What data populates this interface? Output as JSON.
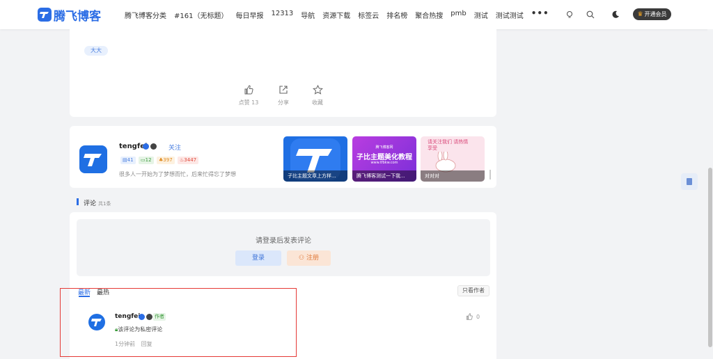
{
  "header": {
    "logo_text": "腾飞博客",
    "nav": [
      "腾飞博客分类",
      "#161（无标题）",
      "每日早报",
      "12313",
      "导航",
      "资源下载",
      "标签云",
      "排名榜",
      "聚合热搜",
      "pmb",
      "测试",
      "测试测试"
    ],
    "more_label": "•••",
    "icons": [
      "lightbulb-icon",
      "search-icon",
      "moon-icon"
    ],
    "vip_label": "开通会员"
  },
  "post": {
    "tag": "大大",
    "actions": [
      {
        "icon": "thumbs-up-icon",
        "label": "点赞 13"
      },
      {
        "icon": "share-icon",
        "label": "分享"
      },
      {
        "icon": "star-icon",
        "label": "收藏"
      }
    ]
  },
  "author": {
    "name": "tengfei",
    "follow_label": "关注",
    "stats": [
      {
        "icon": "article-icon",
        "value": "41",
        "color": "#4a7fe0",
        "bg": "#e8f0fd"
      },
      {
        "icon": "comment-icon",
        "value": "12",
        "color": "#3a9a3a",
        "bg": "#e6f4e6"
      },
      {
        "icon": "like-icon",
        "value": "397",
        "color": "#e08a1e",
        "bg": "#fdf1e0"
      },
      {
        "icon": "fire-icon",
        "value": "3447",
        "color": "#e0483a",
        "bg": "#fde8e6"
      }
    ],
    "bio": "很多人一开始为了梦想而忙，后来忙得忘了梦想",
    "posts": [
      {
        "caption": "子比主题文章上方样..."
      },
      {
        "caption": "腾飞博客测试一下我...",
        "banner_small": "腾飞博客网",
        "banner_big": "子比主题美化教程",
        "banner_url": "www.tfbkw.com"
      },
      {
        "caption": "对对对",
        "banner_text": "请关注我们 请热情享受"
      }
    ]
  },
  "comments": {
    "title": "评论",
    "count": "共1条",
    "login_hint": "请登录后发表评论",
    "login_label": "登录",
    "register_label": "注册",
    "sort_latest": "最新",
    "sort_hot": "最热",
    "only_author_label": "只看作者",
    "items": [
      {
        "name": "tengfei",
        "author_tag": "作者",
        "text": "该评论为私密评论",
        "time": "1分钟前",
        "reply_label": "回复",
        "likes": "0"
      }
    ]
  },
  "colors": {
    "accent": "#2b6de5",
    "highlight_box": "#e53935"
  }
}
